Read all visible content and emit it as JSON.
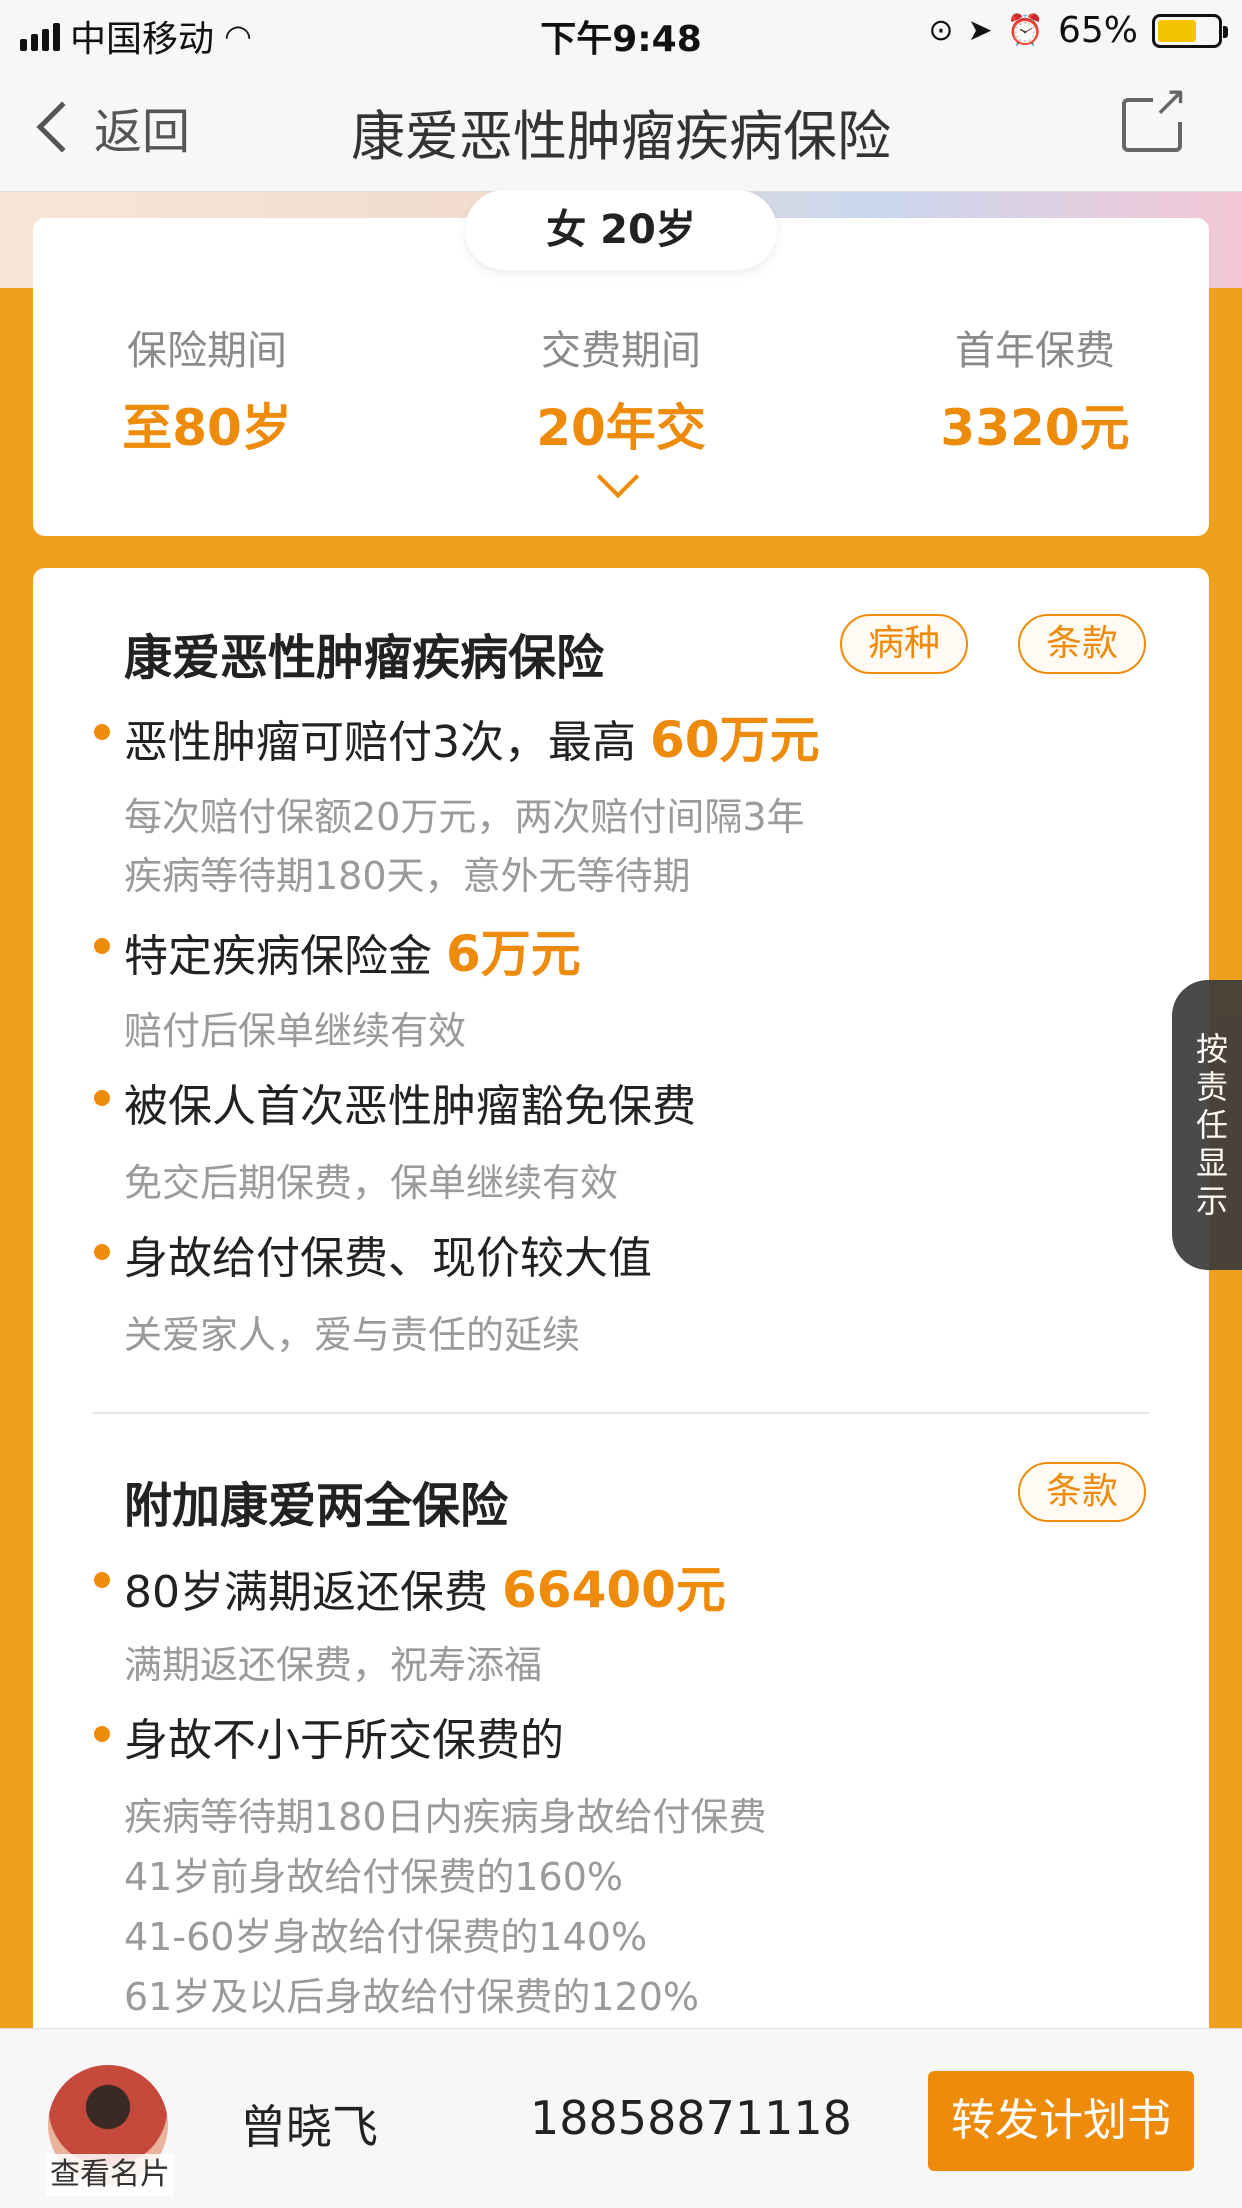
{
  "status_bar": {
    "carrier": "中国移动",
    "time": "下午9:48",
    "battery": "65%",
    "battery_level": 0.65,
    "icons": [
      "signal-icon",
      "wifi-icon",
      "orientation-lock-icon",
      "location-icon",
      "alarm-icon",
      "battery-icon"
    ]
  },
  "nav": {
    "back_label": "返回",
    "title": "康爱恶性肿瘤疾病保险",
    "share_icon": "share-icon"
  },
  "summary": {
    "insured": "女 20岁",
    "stats": [
      {
        "label": "保险期间",
        "value": "至80岁"
      },
      {
        "label": "交费期间",
        "value": "20年交"
      },
      {
        "label": "首年保费",
        "value": "3320元"
      }
    ]
  },
  "main_product": {
    "title": "康爱恶性肿瘤疾病保险",
    "tags": [
      "病种",
      "条款"
    ],
    "items": [
      {
        "text": "恶性肿瘤可赔付3次，最高 ",
        "highlight": "60万元",
        "subs": [
          "每次赔付保额20万元，两次赔付间隔3年",
          "疾病等待期180天，意外无等待期"
        ]
      },
      {
        "text": "特定疾病保险金 ",
        "highlight": "6万元",
        "subs": [
          "赔付后保单继续有效"
        ]
      },
      {
        "text": "被保人首次恶性肿瘤豁免保费",
        "highlight": "",
        "subs": [
          "免交后期保费，保单继续有效"
        ]
      },
      {
        "text": "身故给付保费、现价较大值",
        "highlight": "",
        "subs": [
          "关爱家人，爱与责任的延续"
        ]
      }
    ]
  },
  "rider_product": {
    "title": "附加康爱两全保险",
    "tags": [
      "条款"
    ],
    "items": [
      {
        "text": "80岁满期返还保费 ",
        "highlight": "66400元",
        "subs": [
          "满期返还保费，祝寿添福"
        ]
      },
      {
        "text": "身故不小于所交保费的",
        "highlight": "",
        "subs": [
          "疾病等待期180日内疾病身故给付保费",
          "41岁前身故给付保费的160%",
          "41-60岁身故给付保费的140%",
          "61岁及以后身故给付保费的120%"
        ]
      }
    ]
  },
  "side_tab": {
    "chars": [
      "按",
      "责",
      "任",
      "显",
      "示"
    ]
  },
  "agent": {
    "view_card": "查看名片",
    "name": "曾晓飞",
    "phone": "18858871118",
    "forward_button": "转发计划书"
  },
  "colors": {
    "accent": "#EE8B0B",
    "background": "#F19F1E"
  }
}
